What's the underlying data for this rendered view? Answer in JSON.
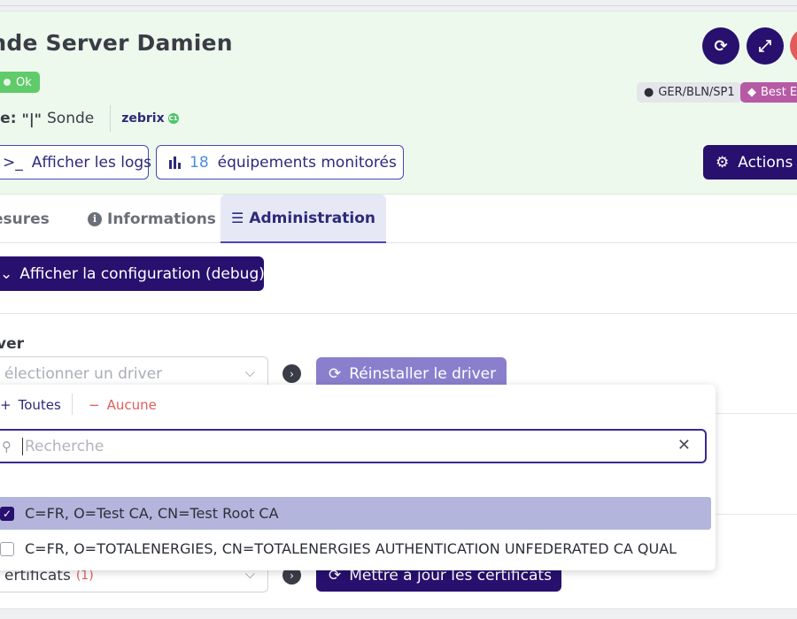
{
  "header": {
    "title": "onde Server Damien",
    "status": "Ok",
    "type_label": "pe:",
    "type_icon": "\"|\"",
    "type_value": "Sonde",
    "brand": "zebrix",
    "brand_badge": "C1",
    "location_tag": "GER/BLN/SP1",
    "best_tag": "Best E",
    "logs_button": "Afficher les logs",
    "equipment_count": "18",
    "equipment_label": "équipements monitorés",
    "actions_button": "Actions"
  },
  "tabs": {
    "mesures": "esures",
    "informations": "Informations",
    "administration": "Administration"
  },
  "admin": {
    "debug_button": "Afficher la configuration (debug)",
    "driver_label": "ver",
    "driver_placeholder": "électionner un driver",
    "reinstall_button": "Réinstaller le driver",
    "certificats_value": "ertificats",
    "certificats_count": "(1)",
    "update_button": "Mettre à jour les certificats"
  },
  "dropdown": {
    "select_all": "Toutes",
    "select_none": "Aucune",
    "search_placeholder": "Recherche",
    "options": [
      {
        "label": "C=FR, O=Test CA, CN=Test Root CA",
        "checked": true
      },
      {
        "label": "C=FR, O=TOTALENERGIES, CN=TOTALENERGIES AUTHENTICATION UNFEDERATED CA QUAL",
        "checked": false
      }
    ]
  },
  "colors": {
    "primary": "#27106e",
    "success": "#5fcb6a",
    "danger": "#e25b5b",
    "header_bg": "#eef9ee"
  }
}
